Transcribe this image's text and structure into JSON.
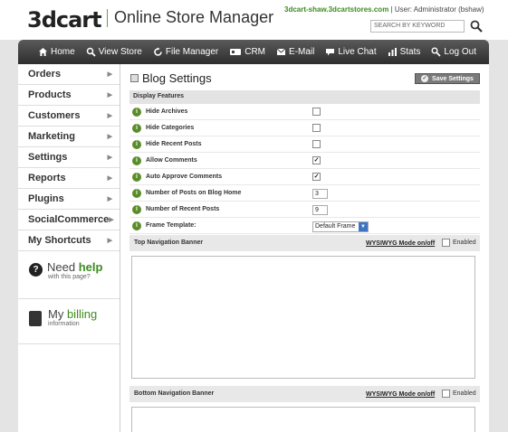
{
  "header": {
    "logo": "3dcart",
    "app_title": "Online Store Manager",
    "store": "3dcart-shaw.3dcartstores.com",
    "user": "| User: Administrator (bshaw)",
    "search_placeholder": "SEARCH BY KEYWORD"
  },
  "nav": [
    {
      "label": "Home",
      "icon": "home-icon"
    },
    {
      "label": "View Store",
      "icon": "magnifier-icon"
    },
    {
      "label": "File Manager",
      "icon": "refresh-icon"
    },
    {
      "label": "CRM",
      "icon": "crm-icon"
    },
    {
      "label": "E-Mail",
      "icon": "email-icon"
    },
    {
      "label": "Live Chat",
      "icon": "chat-icon"
    },
    {
      "label": "Stats",
      "icon": "stats-icon"
    },
    {
      "label": "Log Out",
      "icon": "logout-icon"
    }
  ],
  "sidebar": {
    "items": [
      "Orders",
      "Products",
      "Customers",
      "Marketing",
      "Settings",
      "Reports",
      "Plugins",
      "SocialCommerce",
      "My Shortcuts"
    ],
    "help": {
      "need": "Need ",
      "help": "help",
      "sub": "with this page?"
    },
    "billing": {
      "my": "My ",
      "billing": "billing",
      "sub": "information"
    }
  },
  "main": {
    "title": "Blog Settings",
    "save_label": "Save Settings",
    "section_label": "Display Features",
    "rows": [
      {
        "label": "Hide Archives",
        "type": "checkbox",
        "checked": false
      },
      {
        "label": "Hide Categories",
        "type": "checkbox",
        "checked": false
      },
      {
        "label": "Hide Recent Posts",
        "type": "checkbox",
        "checked": false
      },
      {
        "label": "Allow Comments",
        "type": "checkbox",
        "checked": true
      },
      {
        "label": "Auto Approve Comments",
        "type": "checkbox",
        "checked": true
      },
      {
        "label": "Number of Posts on Blog Home",
        "type": "text",
        "value": "3"
      },
      {
        "label": "Number of Recent Posts",
        "type": "text",
        "value": "9"
      },
      {
        "label": "Frame Template:",
        "type": "select",
        "value": "Default Frame"
      }
    ],
    "top_banner": {
      "title": "Top Navigation Banner",
      "wysiwyg": "WYSIWYG Mode on/off",
      "enabled": "Enabled"
    },
    "bottom_banner": {
      "title": "Bottom Navigation Banner",
      "wysiwyg": "WYSIWYG Mode on/off",
      "enabled": "Enabled"
    }
  },
  "colors": {
    "accent": "#3c8c1e",
    "nav_dark": "#2d2d2d",
    "info_icon": "#5b8c2a",
    "select_arrow": "#3d74c4"
  }
}
